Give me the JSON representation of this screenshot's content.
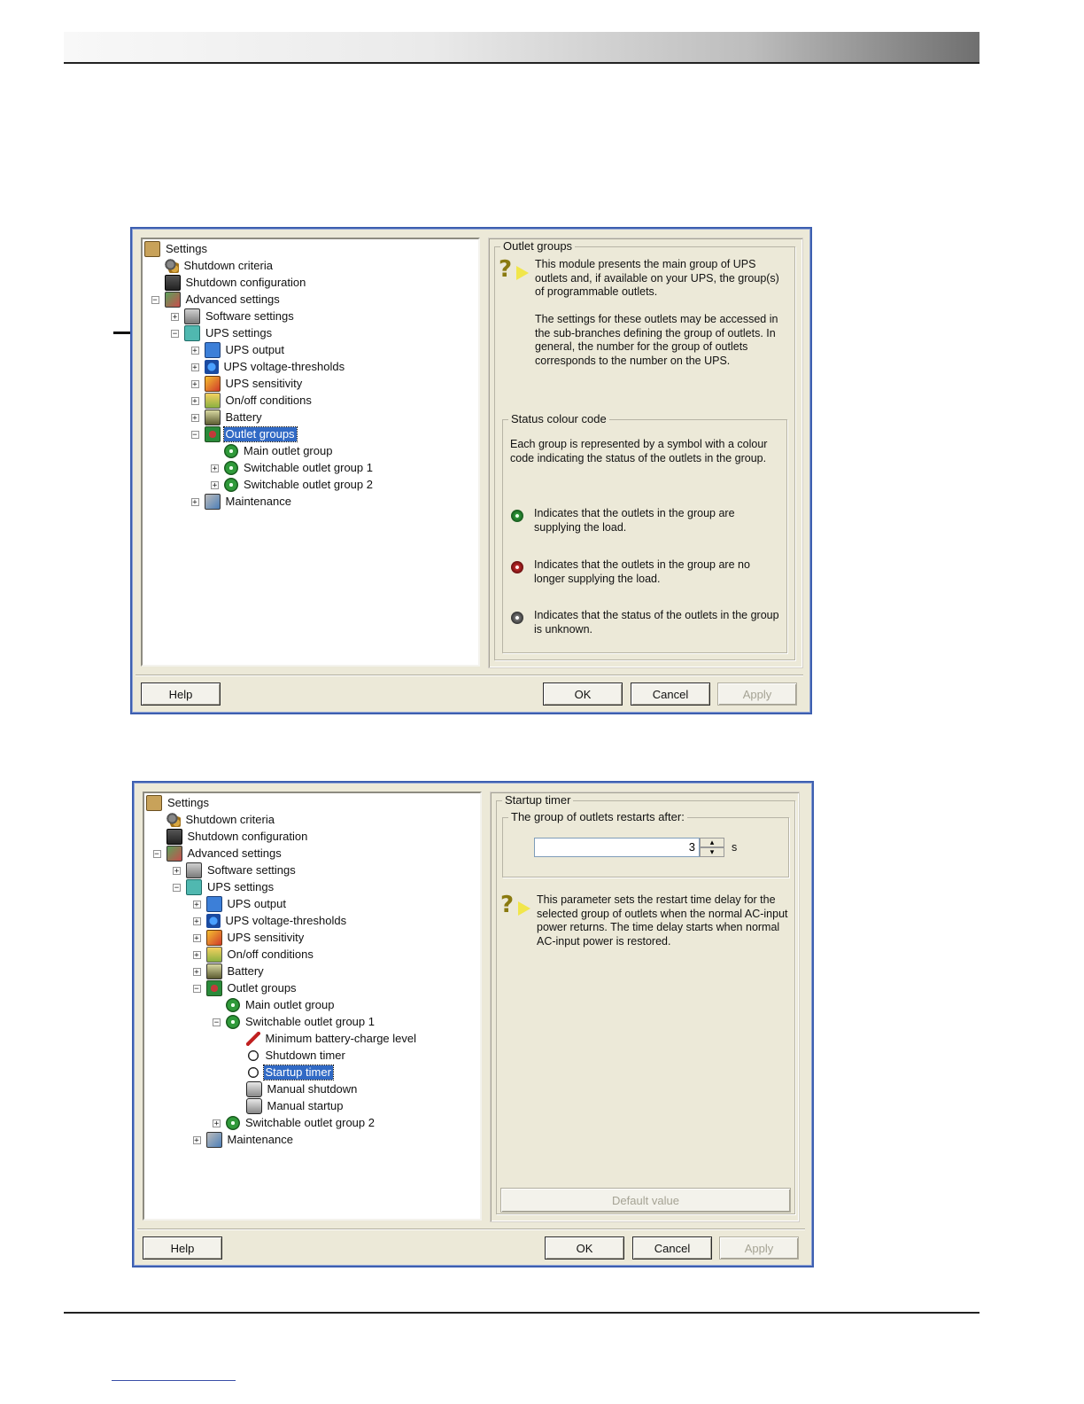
{
  "dialog1": {
    "tree": [
      {
        "label": "Settings",
        "icon": "settings-icon",
        "level": 0,
        "expander": ""
      },
      {
        "label": "Shutdown criteria",
        "icon": "gears-icon",
        "level": 1,
        "expander": ""
      },
      {
        "label": "Shutdown configuration",
        "icon": "shutdown-config-icon",
        "level": 1,
        "expander": ""
      },
      {
        "label": "Advanced settings",
        "icon": "advanced-settings-icon",
        "level": 1,
        "expander": "−"
      },
      {
        "label": "Software settings",
        "icon": "computer-icon",
        "level": 2,
        "expander": "+"
      },
      {
        "label": "UPS settings",
        "icon": "ups-icon",
        "level": 2,
        "expander": "−"
      },
      {
        "label": "UPS output",
        "icon": "ups-output-icon",
        "level": 3,
        "expander": "+"
      },
      {
        "label": "UPS voltage-thresholds",
        "icon": "voltage-icon",
        "level": 3,
        "expander": "+"
      },
      {
        "label": "UPS sensitivity",
        "icon": "sensitivity-icon",
        "level": 3,
        "expander": "+"
      },
      {
        "label": "On/off conditions",
        "icon": "onoff-icon",
        "level": 3,
        "expander": "+"
      },
      {
        "label": "Battery",
        "icon": "battery-icon",
        "level": 3,
        "expander": "+"
      },
      {
        "label": "Outlet groups",
        "icon": "outlet-groups-icon",
        "level": 3,
        "expander": "−",
        "selected": true
      },
      {
        "label": "Main outlet group",
        "icon": "green-outlet-icon",
        "level": 4,
        "expander": ""
      },
      {
        "label": "Switchable outlet group 1",
        "icon": "green-outlet-icon",
        "level": 4,
        "expander": "+"
      },
      {
        "label": "Switchable outlet group 2",
        "icon": "green-outlet-icon",
        "level": 4,
        "expander": "+"
      },
      {
        "label": "Maintenance",
        "icon": "maintenance-icon",
        "level": 3,
        "expander": "+"
      }
    ],
    "outlet_groups_title": "Outlet groups",
    "info_p1": "This module presents the main group of UPS outlets and, if available on your UPS, the group(s) of programmable outlets.",
    "info_p2": "The settings for these outlets may be accessed in the sub-branches defining the group of outlets. In general, the number for the group of outlets corresponds to the number on the UPS.",
    "status_title": "Status colour code",
    "status_intro": "Each group is represented by a symbol with a colour code indicating the status of the outlets in the group.",
    "status_green": "Indicates that the outlets in the group are supplying the load.",
    "status_red": "Indicates that the outlets in the group are no longer supplying the load.",
    "status_grey": "Indicates that the status of the outlets in the group is unknown.",
    "help": "Help",
    "ok": "OK",
    "cancel": "Cancel",
    "apply": "Apply"
  },
  "dialog2": {
    "tree": [
      {
        "label": "Settings",
        "icon": "settings-icon",
        "level": 0,
        "expander": ""
      },
      {
        "label": "Shutdown criteria",
        "icon": "gears-icon",
        "level": 1,
        "expander": ""
      },
      {
        "label": "Shutdown configuration",
        "icon": "shutdown-config-icon",
        "level": 1,
        "expander": ""
      },
      {
        "label": "Advanced settings",
        "icon": "advanced-settings-icon",
        "level": 1,
        "expander": "−"
      },
      {
        "label": "Software settings",
        "icon": "computer-icon",
        "level": 2,
        "expander": "+"
      },
      {
        "label": "UPS settings",
        "icon": "ups-icon",
        "level": 2,
        "expander": "−"
      },
      {
        "label": "UPS output",
        "icon": "ups-output-icon",
        "level": 3,
        "expander": "+"
      },
      {
        "label": "UPS voltage-thresholds",
        "icon": "voltage-icon",
        "level": 3,
        "expander": "+"
      },
      {
        "label": "UPS sensitivity",
        "icon": "sensitivity-icon",
        "level": 3,
        "expander": "+"
      },
      {
        "label": "On/off conditions",
        "icon": "onoff-icon",
        "level": 3,
        "expander": "+"
      },
      {
        "label": "Battery",
        "icon": "battery-icon",
        "level": 3,
        "expander": "+"
      },
      {
        "label": "Outlet groups",
        "icon": "outlet-groups-icon",
        "level": 3,
        "expander": "−"
      },
      {
        "label": "Main outlet group",
        "icon": "green-outlet-icon",
        "level": 4,
        "expander": ""
      },
      {
        "label": "Switchable outlet group 1",
        "icon": "green-outlet-icon",
        "level": 4,
        "expander": "−"
      },
      {
        "label": "Minimum battery-charge level",
        "icon": "wrench-icon",
        "level": 5,
        "expander": ""
      },
      {
        "label": "Shutdown timer",
        "icon": "timer-icon",
        "level": 5,
        "expander": ""
      },
      {
        "label": "Startup timer",
        "icon": "timer-icon",
        "level": 5,
        "expander": "",
        "selected": true
      },
      {
        "label": "Manual shutdown",
        "icon": "hand-icon",
        "level": 5,
        "expander": ""
      },
      {
        "label": "Manual startup",
        "icon": "hand-icon",
        "level": 5,
        "expander": ""
      },
      {
        "label": "Switchable outlet group 2",
        "icon": "green-outlet-icon",
        "level": 4,
        "expander": "+"
      },
      {
        "label": "Maintenance",
        "icon": "maintenance-icon",
        "level": 3,
        "expander": "+"
      }
    ],
    "startup_title": "Startup timer",
    "restart_label": "The group of outlets restarts after:",
    "restart_value": "3",
    "unit": "s",
    "info": "This parameter sets the restart time delay for the selected group of outlets when the normal AC-input power returns. The time delay starts when normal AC-input power is restored.",
    "default_value": "Default value",
    "help": "Help",
    "ok": "OK",
    "cancel": "Cancel",
    "apply": "Apply"
  }
}
